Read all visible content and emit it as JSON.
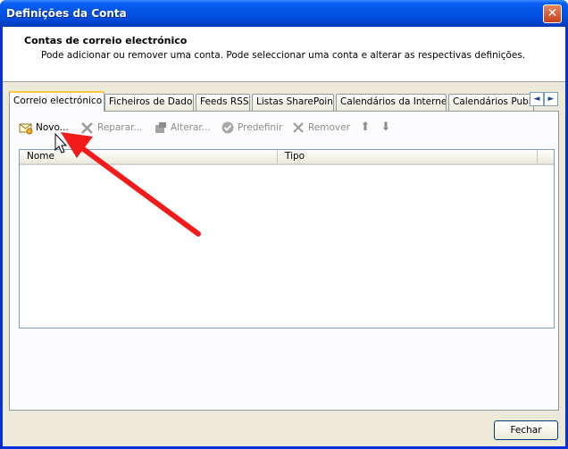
{
  "window": {
    "title": "Definições da Conta",
    "close_glyph": "✕"
  },
  "header": {
    "title": "Contas de correio electrónico",
    "description": "Pode adicionar ou remover uma conta. Pode seleccionar uma conta e alterar as respectivas definições."
  },
  "tabs": [
    {
      "label": "Correio electrónico",
      "active": true
    },
    {
      "label": "Ficheiros de Dados"
    },
    {
      "label": "Feeds RSS"
    },
    {
      "label": "Listas SharePoint"
    },
    {
      "label": "Calendários da Internet"
    },
    {
      "label": "Calendários Publicados"
    }
  ],
  "tab_scroll": {
    "left": "◄",
    "right": "►"
  },
  "toolbar": {
    "new_label": "Novo...",
    "repair_label": "Reparar...",
    "change_label": "Alterar...",
    "default_label": "Predefinir",
    "remove_label": "Remover",
    "up_glyph": "⬆",
    "down_glyph": "⬇",
    "new_icon": "mail-envelope-icon",
    "repair_icon": "tools-icon",
    "change_icon": "account-icon",
    "default_icon": "checkmark-circle-icon",
    "remove_icon": "x-icon"
  },
  "list": {
    "columns": [
      "Nome",
      "Tipo"
    ],
    "rows": []
  },
  "footer": {
    "close_label": "Fechar"
  },
  "colors": {
    "titlebar": "#0254e6",
    "annotation_arrow": "#f21a1a"
  }
}
